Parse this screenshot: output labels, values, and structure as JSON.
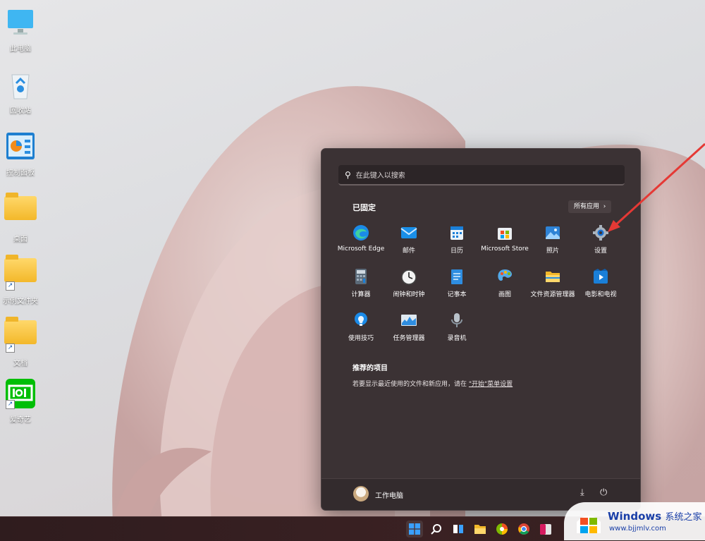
{
  "desktop": {
    "icons": [
      {
        "label": "此电脑"
      },
      {
        "label": "回收站"
      },
      {
        "label": "控制面板"
      },
      {
        "label": "桌面"
      },
      {
        "label": "示例文件夹"
      },
      {
        "label": "文档"
      },
      {
        "label": "爱奇艺"
      }
    ]
  },
  "start_menu": {
    "search_placeholder": "在此键入以搜索",
    "pinned_title": "已固定",
    "all_apps_label": "所有应用",
    "pinned_apps": [
      {
        "label": "Microsoft Edge",
        "icon": "edge-icon"
      },
      {
        "label": "邮件",
        "icon": "mail-icon"
      },
      {
        "label": "日历",
        "icon": "calendar-icon"
      },
      {
        "label": "Microsoft Store",
        "icon": "store-icon"
      },
      {
        "label": "照片",
        "icon": "photos-icon"
      },
      {
        "label": "设置",
        "icon": "gear-icon"
      },
      {
        "label": "计算器",
        "icon": "calculator-icon"
      },
      {
        "label": "闹钟和时钟",
        "icon": "clock-icon"
      },
      {
        "label": "记事本",
        "icon": "notepad-icon"
      },
      {
        "label": "画图",
        "icon": "paint-icon"
      },
      {
        "label": "文件资源管理器",
        "icon": "folder-icon"
      },
      {
        "label": "电影和电视",
        "icon": "movies-icon"
      },
      {
        "label": "使用技巧",
        "icon": "tips-icon"
      },
      {
        "label": "任务管理器",
        "icon": "task-manager-icon"
      },
      {
        "label": "录音机",
        "icon": "recorder-icon"
      }
    ],
    "recommended_title": "推荐的项目",
    "recommended_text": "若要显示最近使用的文件和新应用，请在",
    "recommended_link": "\"开始\"菜单设置",
    "user_name": "工作电脑"
  },
  "watermark": {
    "title": "Windows",
    "subtitle": "系统之家",
    "url": "www.bjjmlv.com"
  },
  "colors": {
    "start_bg": "#3b3234",
    "arrow": "#e53935",
    "accent": "#0a84ff"
  }
}
